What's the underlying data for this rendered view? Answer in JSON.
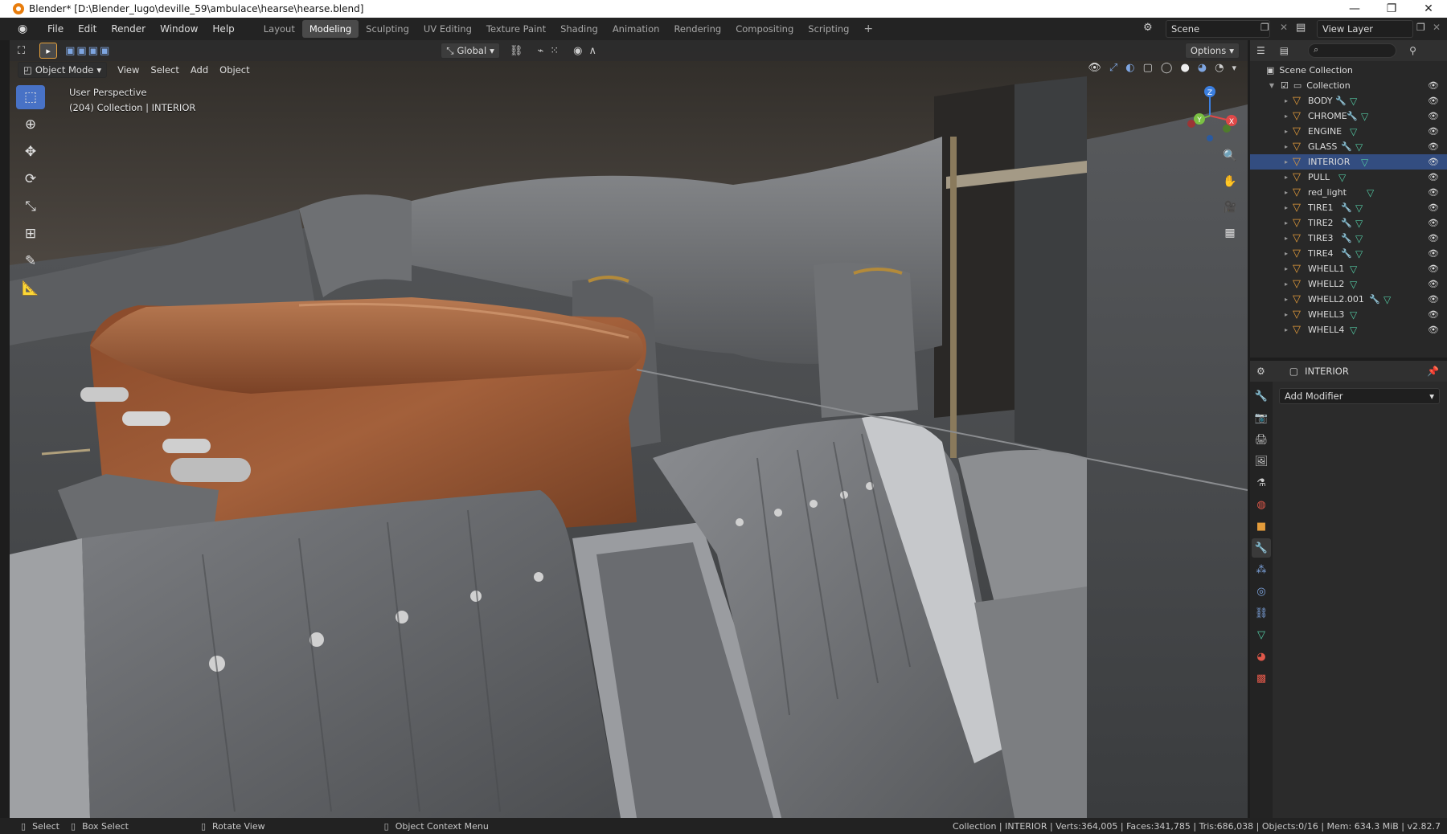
{
  "window": {
    "title": "Blender* [D:\\Blender_lugo\\deville_59\\ambulace\\hearse\\hearse.blend]",
    "minimize": "—",
    "maximize": "❐",
    "close": "✕"
  },
  "menu": [
    "File",
    "Edit",
    "Render",
    "Window",
    "Help"
  ],
  "workspaces": [
    "Layout",
    "Modeling",
    "Sculpting",
    "UV Editing",
    "Texture Paint",
    "Shading",
    "Animation",
    "Rendering",
    "Compositing",
    "Scripting"
  ],
  "active_workspace": "Modeling",
  "scene": {
    "label": "Scene",
    "view_layer": "View Layer"
  },
  "viewport": {
    "mode": "Object Mode",
    "menus": [
      "View",
      "Select",
      "Add",
      "Object"
    ],
    "transform_orientation": "Global",
    "options": "Options",
    "perspective": "User Perspective",
    "collection_info": "(204) Collection | INTERIOR"
  },
  "outliner": {
    "scene_collection": "Scene Collection",
    "collection": "Collection",
    "items": [
      {
        "name": "BODY",
        "modifier": true
      },
      {
        "name": "CHROME",
        "modifier": true
      },
      {
        "name": "ENGINE",
        "modifier": false
      },
      {
        "name": "GLASS",
        "modifier": true
      },
      {
        "name": "INTERIOR",
        "modifier": false,
        "selected": true
      },
      {
        "name": "PULL",
        "modifier": false
      },
      {
        "name": "red_light",
        "modifier": false
      },
      {
        "name": "TIRE1",
        "modifier": true
      },
      {
        "name": "TIRE2",
        "modifier": true
      },
      {
        "name": "TIRE3",
        "modifier": true
      },
      {
        "name": "TIRE4",
        "modifier": true
      },
      {
        "name": "WHELL1",
        "modifier": false
      },
      {
        "name": "WHELL2",
        "modifier": false
      },
      {
        "name": "WHELL2.001",
        "modifier": true
      },
      {
        "name": "WHELL3",
        "modifier": false
      },
      {
        "name": "WHELL4",
        "modifier": false
      }
    ]
  },
  "properties": {
    "object_name": "INTERIOR",
    "add_modifier": "Add Modifier"
  },
  "status": {
    "select": "Select",
    "box_select": "Box Select",
    "rotate": "Rotate View",
    "context_menu": "Object Context Menu",
    "stats": "Collection | INTERIOR | Verts:364,005 | Faces:341,785 | Tris:686,038 | Objects:0/16 | Mem: 634.3 MiB | v2.82.7"
  },
  "gizmo": {
    "x": "X",
    "y": "Y",
    "z": "Z"
  },
  "colors": {
    "accent": "#4872c6",
    "selection": "#334d80",
    "mesh_icon": "#e49c3b",
    "data_icon": "#53c9a3"
  }
}
